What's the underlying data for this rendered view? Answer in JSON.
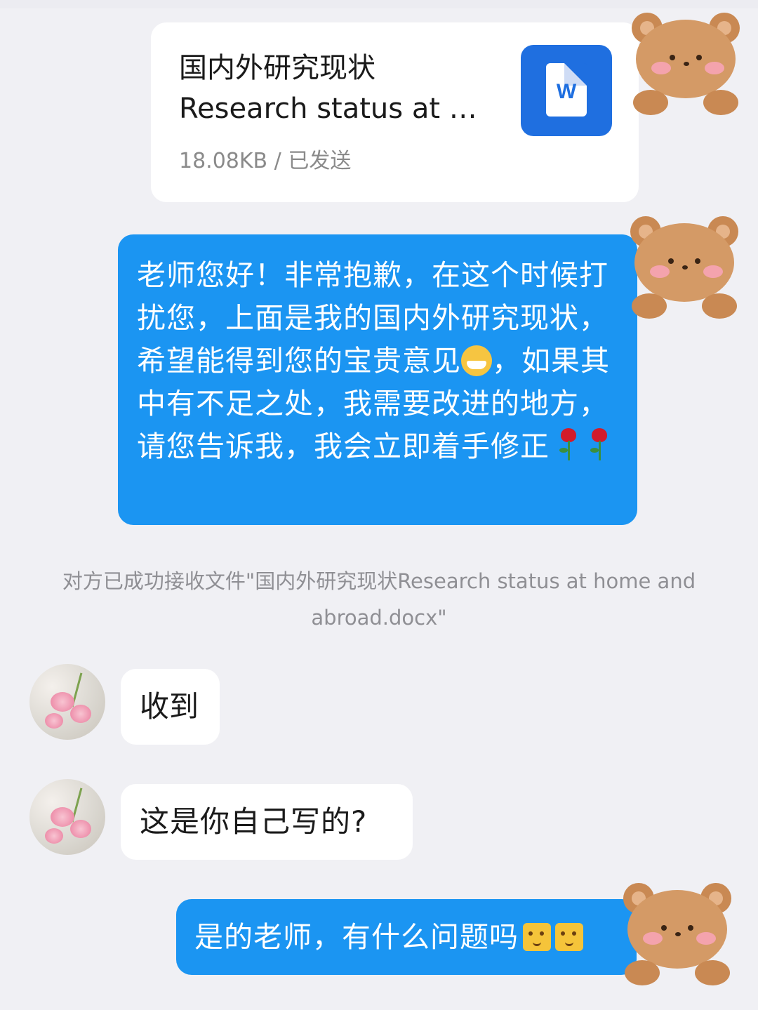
{
  "file_card": {
    "title_line1": "国内外研究现状",
    "title_line2": "Research status at …",
    "meta": "18.08KB / 已发送",
    "icon_letter": "W"
  },
  "messages": [
    {
      "sender": "me",
      "text_before_emoji": "老师您好！非常抱歉，在这个时候打扰您，上面是我的国内外研究现状，希望能得到您的宝贵意见",
      "text_after_emoji": "，如果其中有不足之处，我需要改进的地方，请您告诉我，我会立即着手修正"
    },
    {
      "sender": "them",
      "text": "收到"
    },
    {
      "sender": "them",
      "text": "这是你自己写的?"
    },
    {
      "sender": "me",
      "text": "是的老师，有什么问题吗"
    }
  ],
  "system_note": "对方已成功接收文件\"国内外研究现状Research status at home and abroad.docx\"",
  "colors": {
    "background": "#f0f0f4",
    "my_bubble": "#1b95f2",
    "their_bubble": "#ffffff",
    "word_icon": "#1f6fe0",
    "system_text": "#8f8f94"
  },
  "icons": [
    "word-doc-icon",
    "grin-emoji-icon",
    "rose-emoji-icon",
    "shy-emoji-icon",
    "bear-sticker-icon",
    "flower-avatar"
  ]
}
